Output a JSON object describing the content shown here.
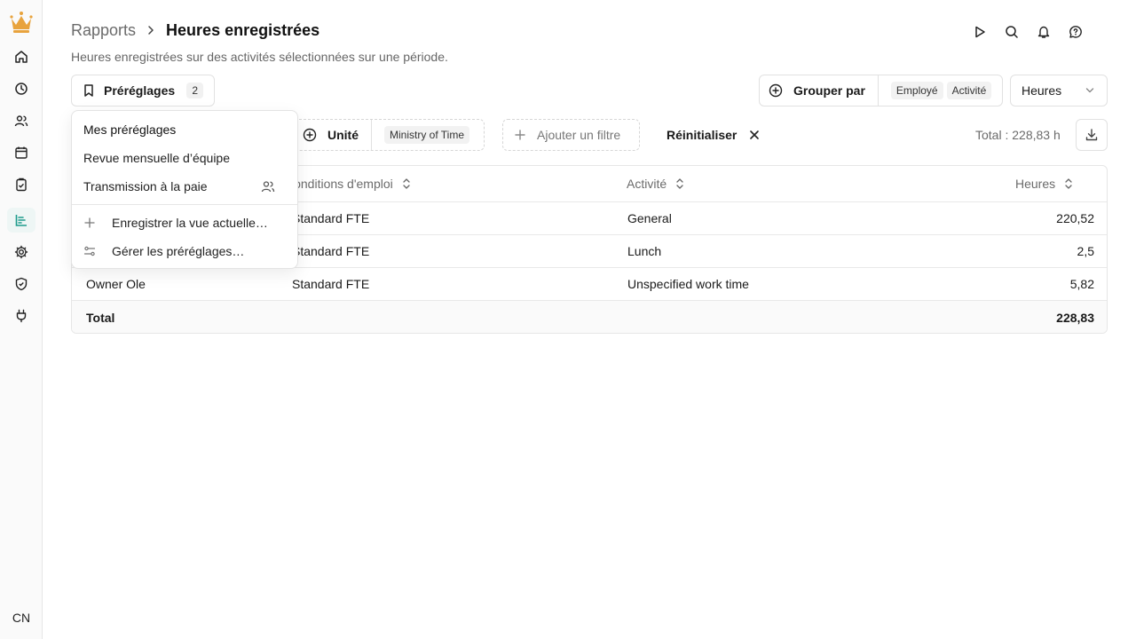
{
  "sidebar": {
    "user_initials": "CN",
    "icons": [
      "crown-logo",
      "home-icon",
      "clock-icon",
      "users-icon",
      "calendar-icon",
      "clipboard-icon",
      "reports-icon",
      "gear-icon",
      "shield-icon",
      "plug-icon"
    ],
    "active": "reports-icon",
    "accent_color": "#e8a33d",
    "active_color": "#1f9c8c"
  },
  "header": {
    "breadcrumb_parent": "Rapports",
    "title": "Heures enregistrées",
    "subtitle": "Heures enregistrées sur des activités sélectionnées sur une période."
  },
  "toolbar": {
    "presets_label": "Préréglages",
    "presets_count": "2",
    "group_by_label": "Grouper par",
    "group_by_tags": [
      "Employé",
      "Activité"
    ],
    "unit_select_value": "Heures",
    "unit_filter_label": "Unité",
    "unit_filter_value": "Ministry of Time",
    "add_filter_label": "Ajouter un filtre",
    "reset_label": "Réinitialiser",
    "total_label": "Total : 228,83 h"
  },
  "table": {
    "columns": [
      "Conditions d'emploi",
      "Activité",
      "Heures"
    ],
    "rows": [
      {
        "employee": "",
        "conditions": "Standard FTE",
        "activity": "General",
        "hours": "220,52"
      },
      {
        "employee": "",
        "conditions": "Standard FTE",
        "activity": "Lunch",
        "hours": "2,5"
      },
      {
        "employee": "Owner Ole",
        "conditions": "Standard FTE",
        "activity": "Unspecified work time",
        "hours": "5,82"
      }
    ],
    "total_label": "Total",
    "total_value": "228,83"
  },
  "dropdown": {
    "heading": "Mes préréglages",
    "items": [
      "Revue mensuelle d’équipe",
      "Transmission à la paie"
    ],
    "shared_item_icon": "users-icon",
    "actions": [
      "Enregistrer la vue actuelle…",
      "Gérer les préréglages…"
    ]
  }
}
